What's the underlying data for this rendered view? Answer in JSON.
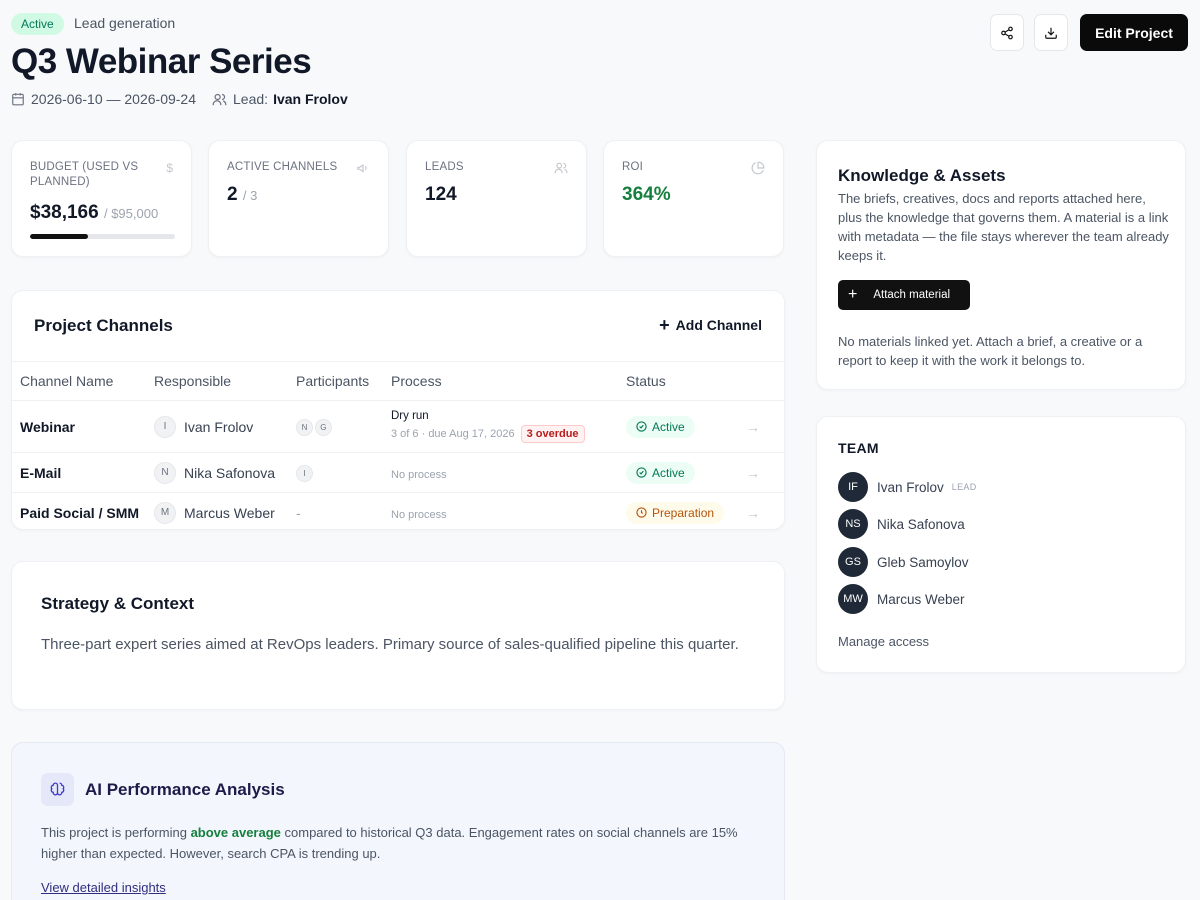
{
  "header": {
    "status": "Active",
    "category": "Lead generation",
    "title": "Q3 Webinar Series",
    "dates": "2026-06-10 — 2026-09-24",
    "lead_label": "Lead:",
    "lead_name": "Ivan Frolov",
    "edit_label": "Edit Project"
  },
  "stats": {
    "budget": {
      "label": "BUDGET (USED VS PLANNED)",
      "value": "$38,166",
      "sub": "/ $95,000",
      "used_fraction": 0.402
    },
    "channels": {
      "label": "ACTIVE CHANNELS",
      "value": "2",
      "sub": "/ 3"
    },
    "leads": {
      "label": "LEADS",
      "value": "124"
    },
    "roi": {
      "label": "ROI",
      "value": "364%"
    }
  },
  "channels": {
    "title": "Project Channels",
    "add_label": "Add Channel",
    "columns": [
      "Channel Name",
      "Responsible",
      "Participants",
      "Process",
      "Status"
    ],
    "rows": [
      {
        "name": "Webinar",
        "responsible_initial": "I",
        "responsible": "Ivan Frolov",
        "participants": [
          "N",
          "G"
        ],
        "process_name": "Dry run",
        "process_progress": "3 of 6",
        "process_due": "· due Aug 17, 2026",
        "overdue": "3 overdue",
        "status": "Active"
      },
      {
        "name": "E-Mail",
        "responsible_initial": "N",
        "responsible": "Nika Safonova",
        "participants": [
          "I"
        ],
        "process": "No process",
        "status": "Active"
      },
      {
        "name": "Paid Social / SMM",
        "responsible_initial": "M",
        "responsible": "Marcus Weber",
        "participants_empty": "-",
        "process": "No process",
        "status": "Preparation"
      }
    ]
  },
  "strategy": {
    "title": "Strategy & Context",
    "text": "Three-part expert series aimed at RevOps leaders. Primary source of sales-qualified pipeline this quarter."
  },
  "ai": {
    "title": "AI Performance Analysis",
    "text_before": "This project is performing ",
    "highlight": "above average",
    "text_after": " compared to historical Q3 data. Engagement rates on social channels are 15% higher than expected. However, search CPA is trending up.",
    "link": "View detailed insights"
  },
  "knowledge": {
    "title": "Knowledge & Assets",
    "description": "The briefs, creatives, docs and reports attached here, plus the knowledge that governs them. A material is a link with metadata — the file stays wherever the team already keeps it.",
    "attach_label": "Attach material",
    "empty": "No materials linked yet. Attach a brief, a creative or a report to keep it with the work it belongs to."
  },
  "team": {
    "title": "TEAM",
    "members": [
      {
        "initials": "IF",
        "name": "Ivan Frolov",
        "tag": "LEAD"
      },
      {
        "initials": "NS",
        "name": "Nika Safonova"
      },
      {
        "initials": "GS",
        "name": "Gleb Samoylov"
      },
      {
        "initials": "MW",
        "name": "Marcus Weber"
      }
    ],
    "manage": "Manage access"
  },
  "colors": {
    "accent": "#0a0a0a",
    "success": "#047857",
    "roi": "#15803d",
    "danger": "#b91c1c",
    "warning": "#b45309"
  }
}
